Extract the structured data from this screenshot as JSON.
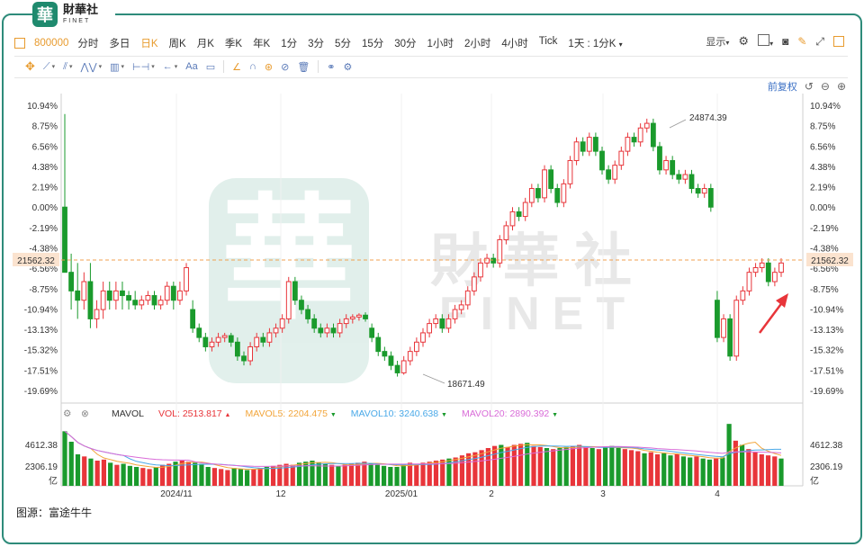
{
  "logo": {
    "cn": "財華社",
    "en": "FINET",
    "badge": "華"
  },
  "toolbar": {
    "code": "800000",
    "periods": [
      "分时",
      "多日",
      "日K",
      "周K",
      "月K",
      "季K",
      "年K",
      "1分",
      "3分",
      "5分",
      "15分",
      "30分",
      "1小时",
      "2小时",
      "4小时",
      "Tick"
    ],
    "active_period": "日K",
    "interval": "1天 : 1分K",
    "display_label": "显示"
  },
  "draw_tools": [
    "cursor-cross",
    "line",
    "channel",
    "pattern",
    "measure",
    "range",
    "arrow",
    "text",
    "note",
    "brush",
    "magnet",
    "lock",
    "hide",
    "delete",
    "compare",
    "settings"
  ],
  "draw_text_label": "Aa",
  "chart_top": {
    "adjust_label": "前复权"
  },
  "axis": {
    "left_ticks": [
      "10.94%",
      "8.75%",
      "6.56%",
      "4.38%",
      "2.19%",
      "0.00%",
      "-2.19%",
      "-4.38%",
      "-6.56%",
      "-8.75%",
      "-10.94%",
      "-13.13%",
      "-15.32%",
      "-17.51%",
      "-19.69%"
    ],
    "right_ticks": [
      "10.94%",
      "8.75%",
      "6.56%",
      "4.38%",
      "2.19%",
      "0.00%",
      "-2.19%",
      "-4.38%",
      "-6.56%",
      "-8.75%",
      "-10.94%",
      "-13.13%",
      "-15.32%",
      "-17.51%",
      "-19.69%"
    ],
    "current_price": "21562.32",
    "x_labels": [
      "2024/11",
      "12",
      "2025/01",
      "2",
      "3",
      "4"
    ],
    "vol_ticks": [
      "4612.38",
      "2306.19",
      "亿"
    ]
  },
  "annotations": {
    "high": "24874.39",
    "low": "18671.49"
  },
  "watermark": {
    "cn": "財華社",
    "en": "FINET"
  },
  "volume_legend": {
    "name": "MAVOL",
    "vol": "VOL: 2513.817",
    "ma5": "MAVOL5: 2204.475",
    "ma10": "MAVOL10: 3240.638",
    "ma20": "MAVOL20: 2890.392"
  },
  "colors": {
    "up": "#e8353a",
    "down": "#1a9a2c",
    "ma5": "#f2a53a",
    "ma10": "#4aa9e8",
    "ma20": "#d96bd8",
    "accent": "#e89b2e",
    "frame": "#2e8b7a"
  },
  "source": "图源：富途牛牛",
  "chart_data": {
    "type": "candlestick",
    "y_unit": "percent change",
    "ylim": [
      -19.69,
      10.94
    ],
    "reference_price": 21562.32,
    "high_label": 24874.39,
    "low_label": 18671.49,
    "candles": [
      [
        0,
        -7,
        10,
        0
      ],
      [
        -7,
        -9,
        -5,
        -11
      ],
      [
        -9,
        -10,
        -6,
        -12
      ],
      [
        -10,
        -8,
        -7,
        -11
      ],
      [
        -8,
        -12,
        -6,
        -13
      ],
      [
        -12,
        -11,
        -10,
        -13
      ],
      [
        -11,
        -9,
        -8,
        -12
      ],
      [
        -9,
        -10,
        -8,
        -11
      ],
      [
        -10,
        -9,
        -8,
        -11
      ],
      [
        -9,
        -9.5,
        -8,
        -11
      ],
      [
        -9.5,
        -10,
        -9,
        -11
      ],
      [
        -10,
        -10.5,
        -9,
        -11
      ],
      [
        -10.5,
        -10,
        -9.5,
        -11
      ],
      [
        -10,
        -9.5,
        -9,
        -10.5
      ],
      [
        -9.5,
        -10.5,
        -9,
        -11
      ],
      [
        -10.5,
        -10,
        -9.5,
        -11
      ],
      [
        -10,
        -8.5,
        -8,
        -10.5
      ],
      [
        -8.5,
        -10,
        -8,
        -11
      ],
      [
        -10,
        -9,
        -8,
        -10.5
      ],
      [
        -9,
        -6.5,
        -6,
        -9.5
      ],
      [
        -11,
        -13,
        -10,
        -13.5
      ],
      [
        -13,
        -14,
        -12.5,
        -14.5
      ],
      [
        -14,
        -15,
        -13.5,
        -15.5
      ],
      [
        -15,
        -14.5,
        -14,
        -15.5
      ],
      [
        -14.5,
        -14,
        -13.5,
        -15
      ],
      [
        -14,
        -13.8,
        -13.5,
        -14.5
      ],
      [
        -13.8,
        -14.5,
        -13.5,
        -15
      ],
      [
        -14.5,
        -16,
        -14,
        -16.5
      ],
      [
        -16,
        -16.5,
        -15.5,
        -17
      ],
      [
        -16.5,
        -15,
        -14.5,
        -17
      ],
      [
        -15,
        -14,
        -13.5,
        -15.5
      ],
      [
        -14,
        -14.5,
        -13.5,
        -15
      ],
      [
        -14.5,
        -13.5,
        -13,
        -15
      ],
      [
        -13.5,
        -13,
        -12.5,
        -14
      ],
      [
        -13,
        -12,
        -11.5,
        -13.5
      ],
      [
        -12,
        -8,
        -7.5,
        -12.5
      ],
      [
        -8,
        -10,
        -7.5,
        -10.5
      ],
      [
        -10,
        -11,
        -9.5,
        -11.5
      ],
      [
        -11,
        -12,
        -10.5,
        -12.5
      ],
      [
        -12,
        -13,
        -11.5,
        -13.5
      ],
      [
        -13,
        -13.5,
        -12.5,
        -14
      ],
      [
        -13.5,
        -13,
        -12.5,
        -14
      ],
      [
        -13,
        -13.5,
        -12.5,
        -14
      ],
      [
        -13.5,
        -12.5,
        -12,
        -14
      ],
      [
        -12.5,
        -12,
        -11.5,
        -13
      ],
      [
        -12,
        -11.8,
        -11.5,
        -12.5
      ],
      [
        -11.8,
        -11.6,
        -11.4,
        -12.2
      ],
      [
        -11.6,
        -12,
        -11.3,
        -12.3
      ],
      [
        -13,
        -14,
        -12.5,
        -14.5
      ],
      [
        -14,
        -15.5,
        -13.5,
        -16
      ],
      [
        -15.5,
        -16,
        -15,
        -16.5
      ],
      [
        -16,
        -17,
        -15.5,
        -17.5
      ],
      [
        -17,
        -17.8,
        -16.5,
        -18.2
      ],
      [
        -17.8,
        -16.5,
        -16,
        -18
      ],
      [
        -16.5,
        -15.5,
        -15,
        -17
      ],
      [
        -15.5,
        -14.5,
        -14,
        -16
      ],
      [
        -14.5,
        -13.5,
        -13,
        -15
      ],
      [
        -13.5,
        -12.5,
        -12,
        -14
      ],
      [
        -12.5,
        -12,
        -11.5,
        -13
      ],
      [
        -12,
        -13,
        -11.5,
        -13.5
      ],
      [
        -13,
        -12,
        -11.5,
        -13.5
      ],
      [
        -12,
        -11,
        -10.5,
        -12.5
      ],
      [
        -11,
        -10.5,
        -10,
        -11.5
      ],
      [
        -10.5,
        -9,
        -8.5,
        -11
      ],
      [
        -9,
        -7.5,
        -7,
        -9.5
      ],
      [
        -7.5,
        -6,
        -5.5,
        -8
      ],
      [
        -6,
        -5.5,
        -5,
        -6.5
      ],
      [
        -5.5,
        -6,
        -5,
        -6.5
      ],
      [
        -6,
        -3.5,
        -3,
        -6.5
      ],
      [
        -3.5,
        -2,
        -1.5,
        -4
      ],
      [
        -2,
        -0.5,
        0,
        -2.5
      ],
      [
        -0.5,
        -1,
        0,
        -1.5
      ],
      [
        -1,
        0.5,
        1,
        -1.5
      ],
      [
        0.5,
        2,
        2.5,
        0
      ],
      [
        2,
        1,
        2.5,
        0.5
      ],
      [
        1,
        4,
        4.5,
        0.5
      ],
      [
        4,
        2,
        4.5,
        1.5
      ],
      [
        2,
        0.5,
        2.5,
        0
      ],
      [
        0.5,
        2.5,
        3,
        0
      ],
      [
        2.5,
        5,
        5.5,
        2
      ],
      [
        5,
        7,
        7.5,
        4.5
      ],
      [
        7,
        6,
        7.5,
        5.5
      ],
      [
        6,
        7.5,
        8,
        5.5
      ],
      [
        7.5,
        6,
        8,
        5.5
      ],
      [
        6,
        4,
        6.5,
        3.5
      ],
      [
        4,
        3,
        4.5,
        2.5
      ],
      [
        3,
        4.5,
        5,
        2.5
      ],
      [
        4.5,
        6,
        6.5,
        4
      ],
      [
        6,
        7.5,
        8,
        5.5
      ],
      [
        7.5,
        7,
        8,
        6.5
      ],
      [
        7,
        8.5,
        9,
        6.5
      ],
      [
        8.5,
        9,
        9.5,
        8
      ],
      [
        9,
        6.5,
        9.5,
        6
      ],
      [
        6.5,
        4,
        7,
        3.5
      ],
      [
        4,
        5,
        5.5,
        3.5
      ],
      [
        5,
        3.5,
        5.5,
        3
      ],
      [
        3.5,
        3,
        4,
        2.5
      ],
      [
        3,
        3.5,
        4,
        2.5
      ],
      [
        3.5,
        2,
        4,
        1.5
      ],
      [
        2,
        1.5,
        2.5,
        1
      ],
      [
        1.5,
        2,
        2.5,
        1
      ],
      [
        2,
        0,
        2.5,
        -0.5
      ],
      [
        -10,
        -14,
        -9,
        -14.5
      ],
      [
        -14,
        -12,
        -11.5,
        -14.5
      ],
      [
        -12,
        -16,
        -11.5,
        -16.5
      ],
      [
        -16,
        -10,
        -9.5,
        -16.5
      ],
      [
        -10,
        -9,
        -8.5,
        -10.5
      ],
      [
        -9,
        -7,
        -6.5,
        -9.5
      ],
      [
        -7,
        -6.5,
        -6,
        -7.5
      ],
      [
        -6.5,
        -6,
        -5.5,
        -7
      ],
      [
        -6,
        -8,
        -5.5,
        -8.5
      ],
      [
        -8,
        -7,
        -6.5,
        -8.5
      ],
      [
        -7,
        -6,
        -5.5,
        -7.5
      ]
    ],
    "volume": {
      "ylim": [
        0,
        6000
      ],
      "ma5_latest": 2204.475,
      "ma10_latest": 3240.638,
      "ma20_latest": 2890.392,
      "bars": [
        5200,
        4200,
        3000,
        2800,
        2600,
        2400,
        2500,
        2200,
        2000,
        2100,
        1900,
        1800,
        1700,
        1600,
        1800,
        2000,
        2100,
        2300,
        2400,
        2300,
        2200,
        2100,
        1800,
        1700,
        1600,
        1500,
        1700,
        1600,
        1500,
        1600,
        1700,
        1800,
        1900,
        2000,
        2100,
        2000,
        2200,
        2300,
        2400,
        2200,
        2100,
        2000,
        1900,
        2000,
        2100,
        2200,
        2300,
        2100,
        2000,
        1900,
        1800,
        1800,
        2000,
        2200,
        2100,
        2200,
        2300,
        2400,
        2500,
        2600,
        2700,
        2900,
        3100,
        3200,
        3400,
        3600,
        3800,
        3900,
        3700,
        3900,
        4000,
        4100,
        3800,
        3700,
        3600,
        3500,
        3600,
        3700,
        3800,
        3900,
        3700,
        3600,
        3500,
        3700,
        3800,
        3600,
        3500,
        3400,
        3300,
        3100,
        3200,
        3000,
        3100,
        2900,
        3000,
        2800,
        2700,
        2800,
        2600,
        2500,
        2600,
        2700,
        5900,
        4300,
        3900,
        3500,
        3200,
        3000,
        2900,
        2800,
        2600
      ]
    }
  }
}
